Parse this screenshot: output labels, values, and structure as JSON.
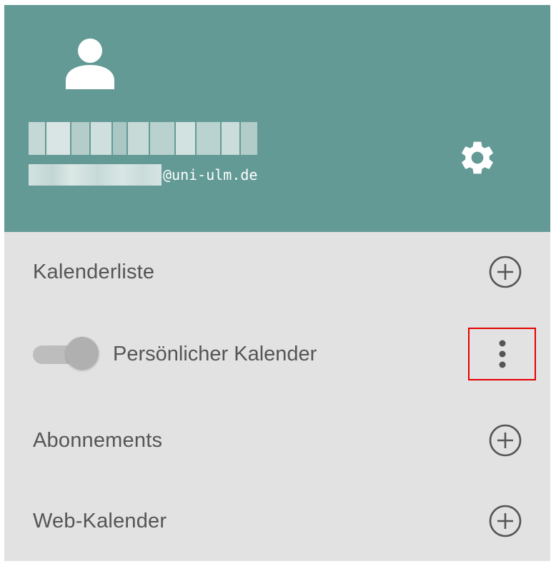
{
  "profile": {
    "name_redacted": "",
    "email_domain": "@uni-ulm.de",
    "avatar_icon": "person-icon",
    "settings_icon": "gear-icon"
  },
  "sections": {
    "calendar_list": {
      "label": "Kalenderliste",
      "icon": "plus-circle-icon"
    },
    "personal_calendar": {
      "label": "Persönlicher Kalender",
      "enabled": true,
      "menu_icon": "more-vertical-icon"
    },
    "subscriptions": {
      "label": "Abonnements",
      "icon": "plus-circle-icon"
    },
    "web_calendar": {
      "label": "Web-Kalender",
      "icon": "plus-circle-icon"
    }
  },
  "colors": {
    "header_bg": "#639a96",
    "panel_bg": "#e2e2e2",
    "text": "#555555",
    "highlight": "#e60000"
  }
}
